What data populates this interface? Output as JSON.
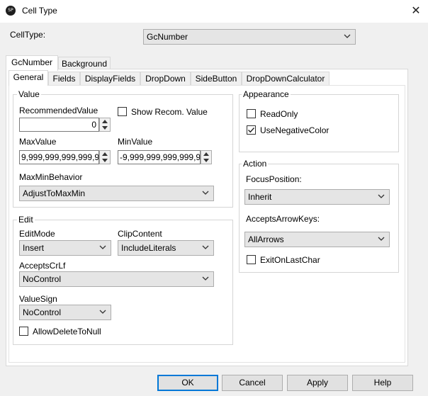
{
  "window": {
    "title": "Cell Type",
    "icon_text": "SP",
    "close_glyph": "✕"
  },
  "celltype": {
    "label": "CellType:",
    "value": "GcNumber"
  },
  "outer_tabs": [
    {
      "label": "GcNumber"
    },
    {
      "label": "Background"
    }
  ],
  "inner_tabs": [
    {
      "label": "General"
    },
    {
      "label": "Fields"
    },
    {
      "label": "DisplayFields"
    },
    {
      "label": "DropDown"
    },
    {
      "label": "SideButton"
    },
    {
      "label": "DropDownCalculator"
    }
  ],
  "value_group": {
    "title": "Value",
    "recommended_label": "RecommendedValue",
    "recommended_value": "0",
    "show_recom_label": "Show Recom. Value",
    "show_recom_checked": false,
    "max_label": "MaxValue",
    "max_value": "9,999,999,999,999,9",
    "min_label": "MinValue",
    "min_value": "-9,999,999,999,999,9",
    "maxmin_label": "MaxMinBehavior",
    "maxmin_value": "AdjustToMaxMin"
  },
  "edit_group": {
    "title": "Edit",
    "editmode_label": "EditMode",
    "editmode_value": "Insert",
    "clip_label": "ClipContent",
    "clip_value": "IncludeLiterals",
    "crlf_label": "AcceptsCrLf",
    "crlf_value": "NoControl",
    "sign_label": "ValueSign",
    "sign_value": "NoControl",
    "allowdelete_label": "AllowDeleteToNull",
    "allowdelete_checked": false
  },
  "appearance_group": {
    "title": "Appearance",
    "readonly_label": "ReadOnly",
    "readonly_checked": false,
    "useneg_label": "UseNegativeColor",
    "useneg_checked": true
  },
  "action_group": {
    "title": "Action",
    "focus_label": "FocusPosition:",
    "focus_value": "Inherit",
    "arrow_label": "AcceptsArrowKeys:",
    "arrow_value": "AllArrows",
    "exit_label": "ExitOnLastChar",
    "exit_checked": false
  },
  "buttons": {
    "ok": "OK",
    "cancel": "Cancel",
    "apply": "Apply",
    "help": "Help"
  }
}
